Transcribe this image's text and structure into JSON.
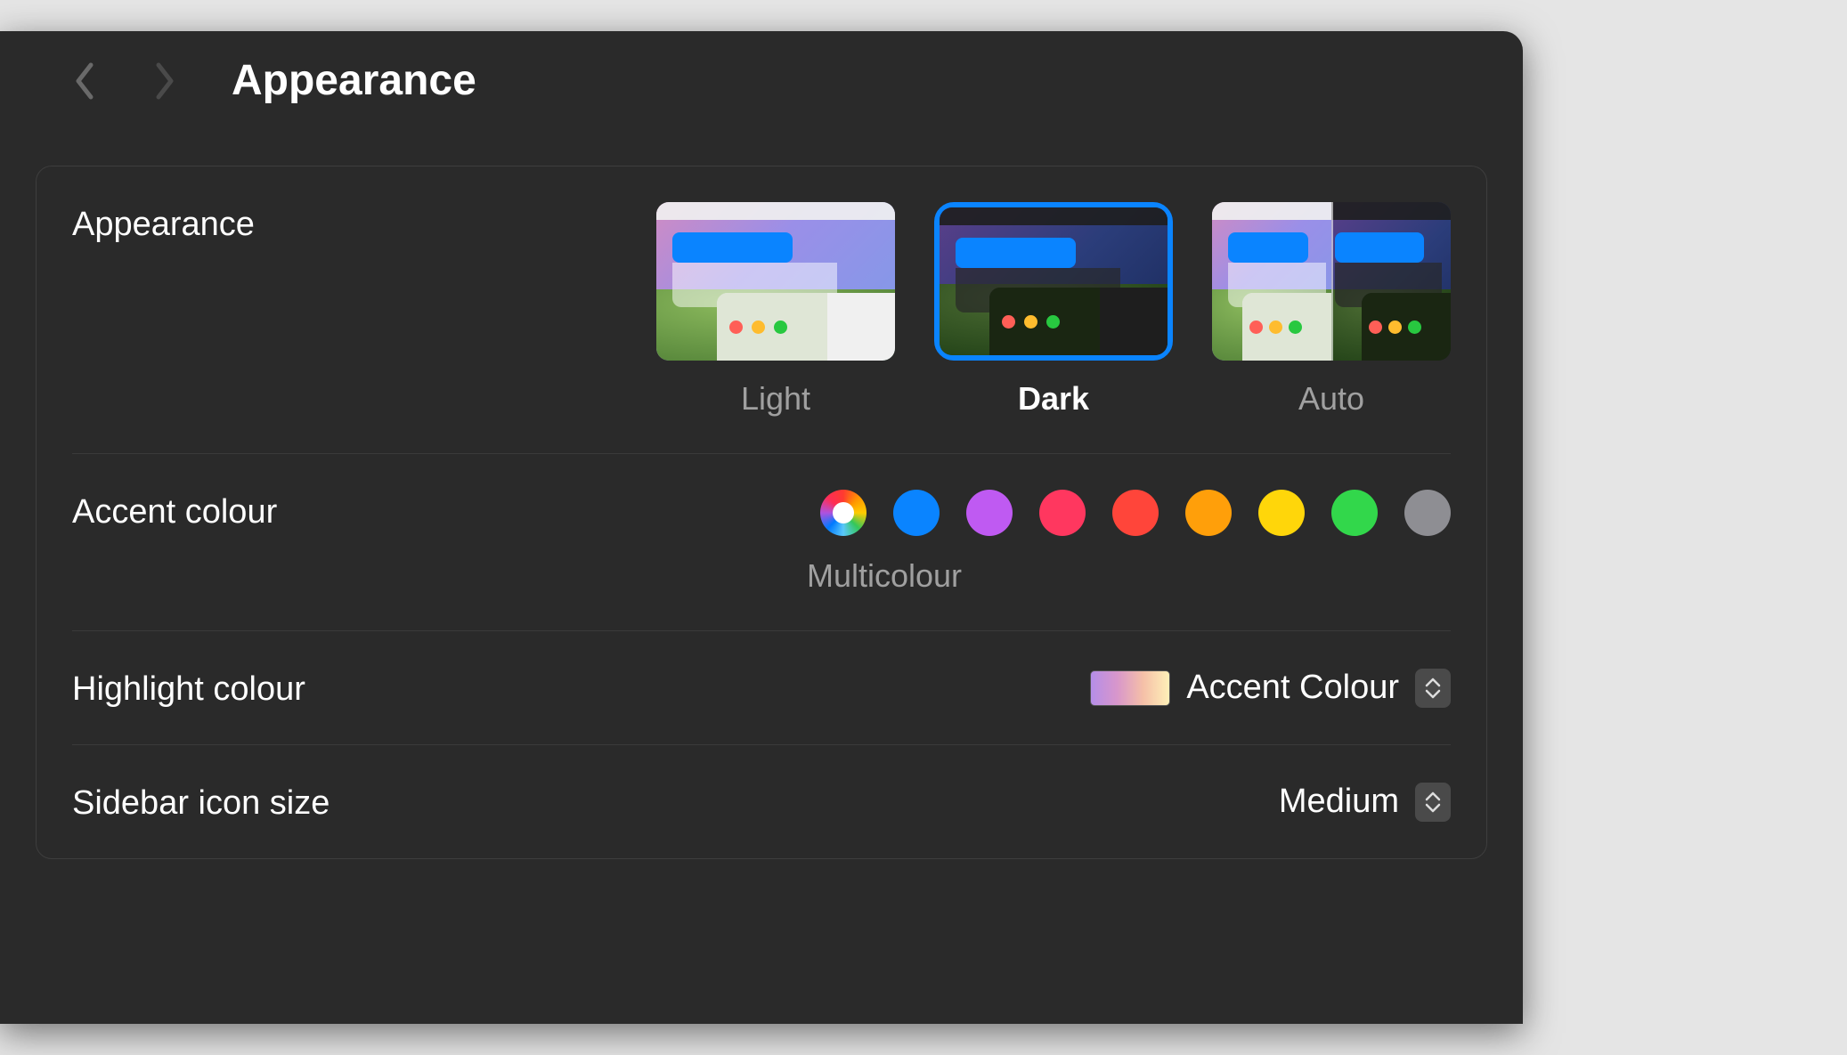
{
  "header": {
    "title": "Appearance"
  },
  "appearance": {
    "label": "Appearance",
    "options": [
      "Light",
      "Dark",
      "Auto"
    ],
    "selected": "Dark"
  },
  "accent": {
    "label": "Accent colour",
    "selected_caption": "Multicolour",
    "colors": {
      "blue": "#0a84ff",
      "purple": "#bf5af2",
      "pink": "#ff375f",
      "red": "#ff453a",
      "orange": "#ff9f0a",
      "yellow": "#ffd60a",
      "green": "#32d74b",
      "graphite": "#8e8e93"
    }
  },
  "highlight": {
    "label": "Highlight colour",
    "value": "Accent Colour"
  },
  "sidebar_icon": {
    "label": "Sidebar icon size",
    "value": "Medium"
  }
}
